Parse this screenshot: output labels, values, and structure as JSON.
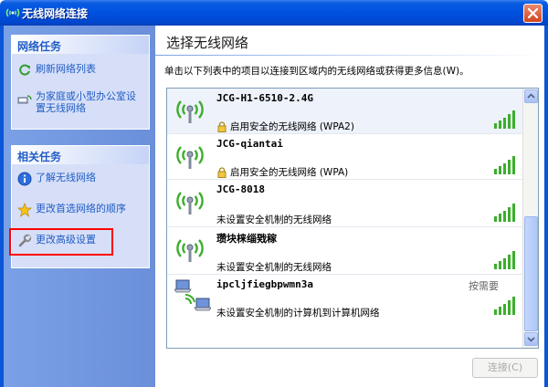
{
  "window": {
    "title": "无线网络连接"
  },
  "sidebar": {
    "network_tasks": {
      "title": "网络任务",
      "items": [
        {
          "label": "刷新网络列表",
          "icon": "refresh-icon"
        },
        {
          "label": "为家庭或小型办公室设置无线网络",
          "icon": "home-network-icon"
        }
      ]
    },
    "related_tasks": {
      "title": "相关任务",
      "items": [
        {
          "label": "了解无线网络",
          "icon": "info-icon"
        },
        {
          "label": "更改首选网络的顺序",
          "icon": "star-icon"
        },
        {
          "label": "更改高级设置",
          "icon": "wrench-icon",
          "highlighted": true
        }
      ]
    }
  },
  "main": {
    "heading": "选择无线网络",
    "description": "单击以下列表中的项目以连接到区域内的无线网络或获得更多信息(W)。",
    "networks": [
      {
        "name": "JCG-H1-6510-2.4G",
        "status": "启用安全的无线网络 (WPA2)",
        "secured": true,
        "signal": 5,
        "selected": true
      },
      {
        "name": "JCG-qiantai",
        "status": "启用安全的无线网络 (WPA)",
        "secured": true,
        "signal": 5,
        "selected": false
      },
      {
        "name": "JCG-8018",
        "status": "未设置安全机制的无线网络",
        "secured": false,
        "signal": 5,
        "selected": false
      },
      {
        "name": "瓒块梾缁戣稼",
        "status": "未设置安全机制的无线网络",
        "secured": false,
        "signal": 5,
        "selected": false
      },
      {
        "name": "ipcljfiegbpwmn3a",
        "status": "未设置安全机制的计算机到计算机网络",
        "secured": false,
        "signal": 5,
        "selected": false,
        "badge": "按需要",
        "type": "ad-hoc"
      }
    ],
    "connect_label": "连接(C)"
  },
  "colors": {
    "titlebar": "#0050e0",
    "taskpane": "#7aa1e6",
    "task_link": "#215dc6",
    "signal": "#3cae2c",
    "highlight": "#ff0000"
  }
}
